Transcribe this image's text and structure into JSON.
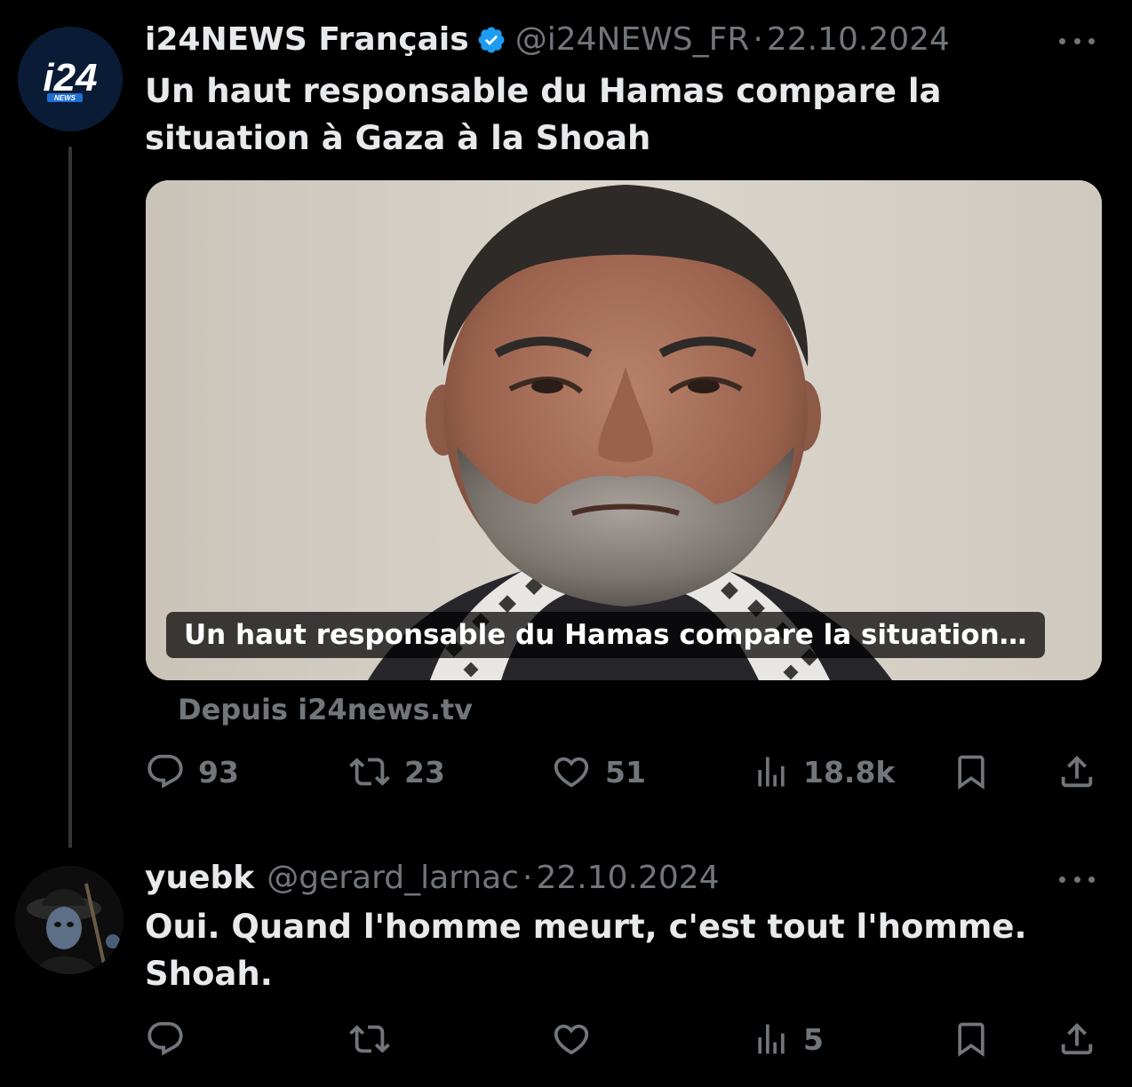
{
  "tweet1": {
    "display_name": "i24NEWS Français",
    "handle": "@i24NEWS_FR",
    "separator": "·",
    "date": "22.10.2024",
    "avatar_logo_text": "i24",
    "avatar_logo_sub": "NEWS",
    "text": "Un haut responsable du Hamas compare la situation à Gaza à la Shoah",
    "card_caption": "Un haut responsable du Hamas compare la situation…",
    "source": "Depuis i24news.tv",
    "replies": "93",
    "reposts": "23",
    "likes": "51",
    "views": "18.8k"
  },
  "tweet2": {
    "display_name": "yuebk",
    "handle": "@gerard_larnac",
    "separator": "·",
    "date": "22.10.2024",
    "text": "Oui. Quand l'homme meurt, c'est tout l'homme. Shoah.",
    "replies": "",
    "reposts": "",
    "likes": "",
    "views": "5"
  },
  "colors": {
    "background": "#000000",
    "text_primary": "#e7e9ea",
    "text_secondary": "#71767b",
    "verified_blue": "#1d9bf0",
    "thread_line": "#333639"
  },
  "icons": [
    "reply-icon",
    "repost-icon",
    "like-icon",
    "views-icon",
    "bookmark-icon",
    "share-icon",
    "more-icon",
    "verified-badge-icon"
  ]
}
